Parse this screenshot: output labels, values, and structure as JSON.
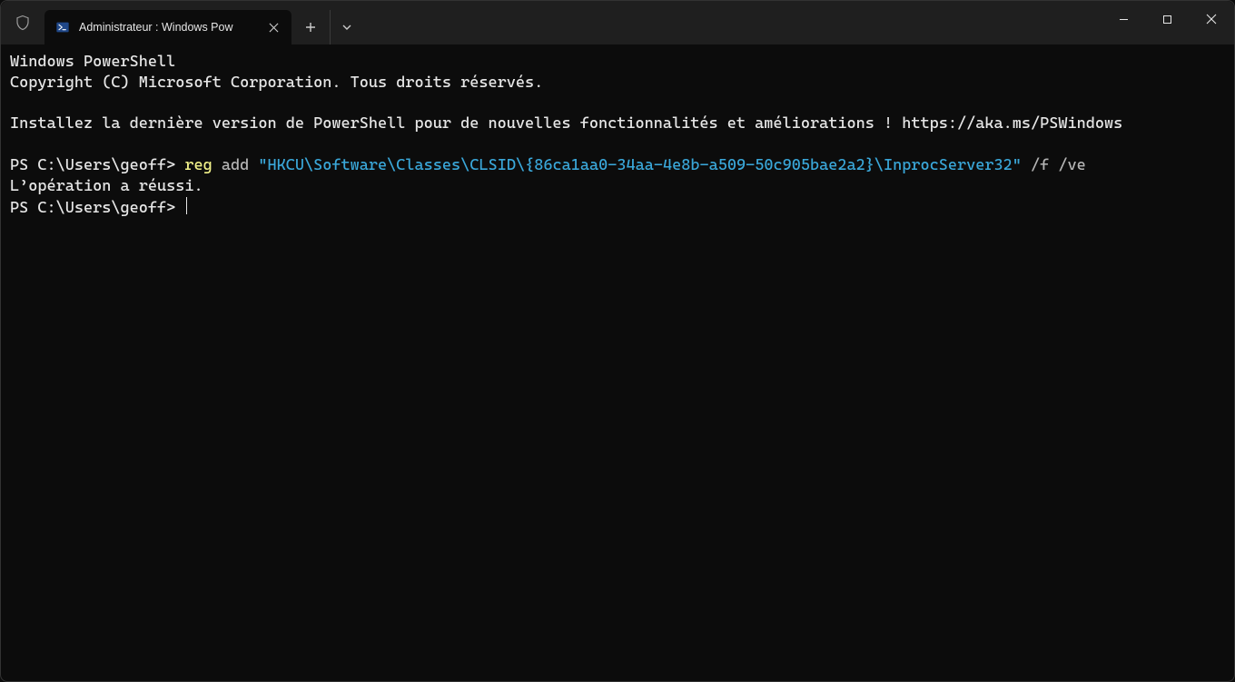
{
  "tab": {
    "title": "Administrateur : Windows Pow"
  },
  "terminal": {
    "header_line1": "Windows PowerShell",
    "header_line2": "Copyright (C) Microsoft Corporation. Tous droits réservés.",
    "hint": "Installez la dernière version de PowerShell pour de nouvelles fonctionnalités et améliorations ! https://aka.ms/PSWindows",
    "prompt1": "PS C:\\Users\\geoff> ",
    "cmd_reg": "reg",
    "cmd_add": " add ",
    "cmd_string": "\"HKCU\\Software\\Classes\\CLSID\\{86ca1aa0-34aa-4e8b-a509-50c905bae2a2}\\InprocServer32\"",
    "cmd_flags": " /f /ve",
    "result": "L’opération a réussi.",
    "prompt2": "PS C:\\Users\\geoff> "
  }
}
